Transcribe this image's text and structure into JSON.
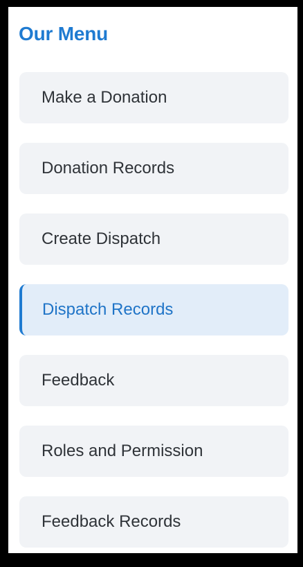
{
  "menu": {
    "title": "Our Menu",
    "items": [
      {
        "label": "Make a Donation",
        "active": false
      },
      {
        "label": "Donation Records",
        "active": false
      },
      {
        "label": "Create Dispatch",
        "active": false
      },
      {
        "label": "Dispatch Records",
        "active": true
      },
      {
        "label": "Feedback",
        "active": false
      },
      {
        "label": "Roles and Permission",
        "active": false
      },
      {
        "label": "Feedback Records",
        "active": false
      }
    ]
  },
  "colors": {
    "accent": "#1f7bd1",
    "item_background": "#f1f3f6",
    "active_background": "#e2edf9",
    "frame": "#000000"
  }
}
